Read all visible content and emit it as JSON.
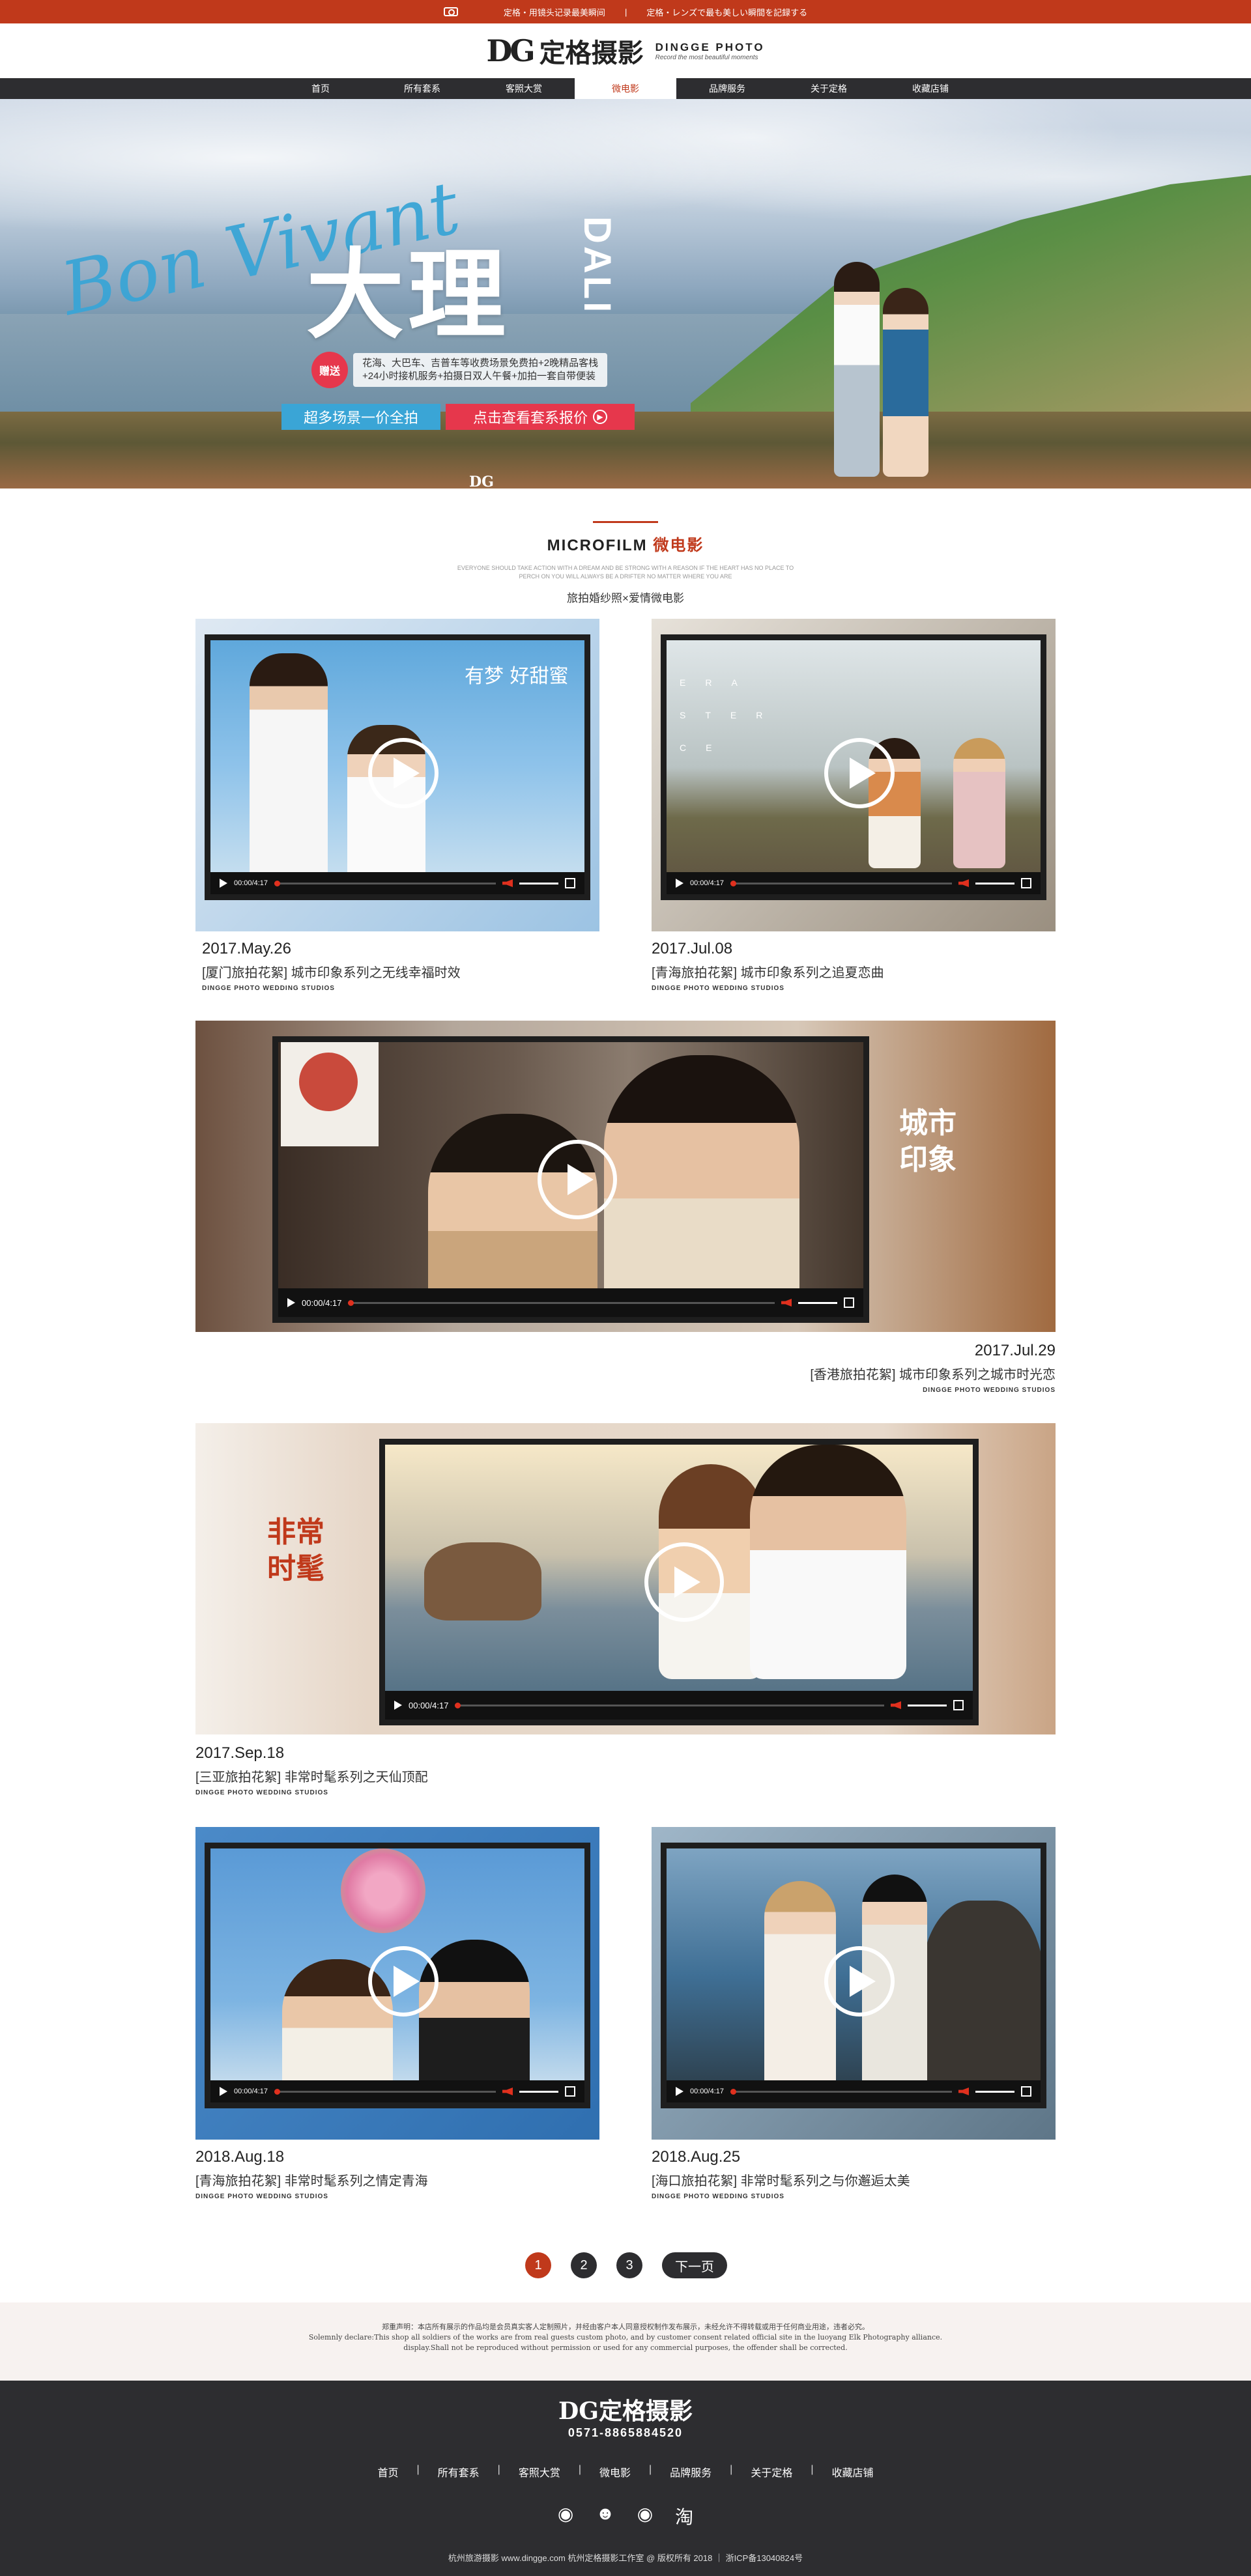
{
  "topbar": {
    "left": "定格・用镜头记录最美瞬间",
    "right": "定格・レンズで最も美しい瞬間を記録する"
  },
  "brand": {
    "mark": "DG",
    "name_cn": "定格摄影",
    "name_en": "DINGGE PHOTO",
    "slogan": "Record the most beautiful moments"
  },
  "nav": {
    "items": [
      "首页",
      "所有套系",
      "客照大赏",
      "微电影",
      "品牌服务",
      "关于定格",
      "收藏店铺"
    ],
    "active_index": 3
  },
  "banner": {
    "script": "Bon Vivant",
    "title_cn": "大理",
    "title_en": "DALI",
    "gift_tag": "赠送",
    "gift_line1": "花海、大巴车、吉普车等收费场景免费拍+2晚精品客栈",
    "gift_line2": "+24小时接机服务+拍摄日双人午餐+加拍一套自带便装",
    "btn_left": "超多场景一价全拍",
    "btn_right": "点击查看套系报价",
    "mini_logo": "DG"
  },
  "section": {
    "title_en": "MICROFILM",
    "title_cn": "微电影",
    "small_line1": "EVERYONE SHOULD TAKE ACTION WITH A DREAM AND BE STRONG WITH A REASON IF THE HEART HAS NO PLACE TO",
    "small_line2": "PERCH ON YOU WILL ALWAYS BE A DRIFTER NO MATTER WHERE YOU ARE",
    "subtitle": "旅拍婚纱照×爱情微电影"
  },
  "videos": [
    {
      "date": "2017.May.26",
      "title": "[厦门旅拍花絮] 城市印象系列之无线幸福时效",
      "studio": "DINGGE PHOTO WEDDING STUDIOS",
      "time": "00:00/4:17",
      "overlay": "有梦 好甜蜜"
    },
    {
      "date": "2017.Jul.08",
      "title": "[青海旅拍花絮] 城市印象系列之追夏恋曲",
      "studio": "DINGGE PHOTO WEDDING STUDIOS",
      "time": "00:00/4:17",
      "overlay": "ERA STER CE"
    },
    {
      "date": "2017.Jul.29",
      "title": "[香港旅拍花絮] 城市印象系列之城市时光恋",
      "studio": "DINGGE PHOTO WEDDING STUDIOS",
      "time": "00:00/4:17",
      "overlay": "城市 印象"
    },
    {
      "date": "2017.Sep.18",
      "title": "[三亚旅拍花絮] 非常时髦系列之天仙顶配",
      "studio": "DINGGE PHOTO WEDDING STUDIOS",
      "time": "00:00/4:17",
      "overlay": "非常 时髦"
    },
    {
      "date": "2018.Aug.18",
      "title": "[青海旅拍花絮] 非常时髦系列之情定青海",
      "studio": "DINGGE PHOTO WEDDING STUDIOS",
      "time": "00:00/4:17",
      "overlay": ""
    },
    {
      "date": "2018.Aug.25",
      "title": "[海口旅拍花絮] 非常时髦系列之与你邂逅太美",
      "studio": "DINGGE PHOTO WEDDING STUDIOS",
      "time": "00:00/4:17",
      "overlay": ""
    }
  ],
  "pager": {
    "pages": [
      "1",
      "2",
      "3"
    ],
    "next": "下一页"
  },
  "disclaimer": {
    "line1": "郑重声明：本店所有展示的作品均是会员真实客人定制照片，并经由客户本人同意授权制作发布展示，未经允许不得转载或用于任何商业用途，违者必究。",
    "line2": "Solemnly declare:This shop all soldiers of the works are from real guests custom photo, and by customer consent related official site in the luoyang Elk Photography alliance.",
    "line3": "display.Shall not be reproduced without permission or used for any commercial purposes, the offender shall be corrected."
  },
  "footer": {
    "logo": "DG定格摄影",
    "phone": "0571-8865884520",
    "nav": [
      "首页",
      "所有套系",
      "客照大赏",
      "微电影",
      "品牌服务",
      "关于定格",
      "收藏店铺"
    ],
    "social": [
      "weibo-icon",
      "qq-icon",
      "wechat-icon",
      "taobao-icon"
    ],
    "copyright": "杭州旅游摄影 www.dingge.com 杭州定格摄影工作室 @ 版权所有 2018 ｜ 浙ICP备13040824号"
  }
}
